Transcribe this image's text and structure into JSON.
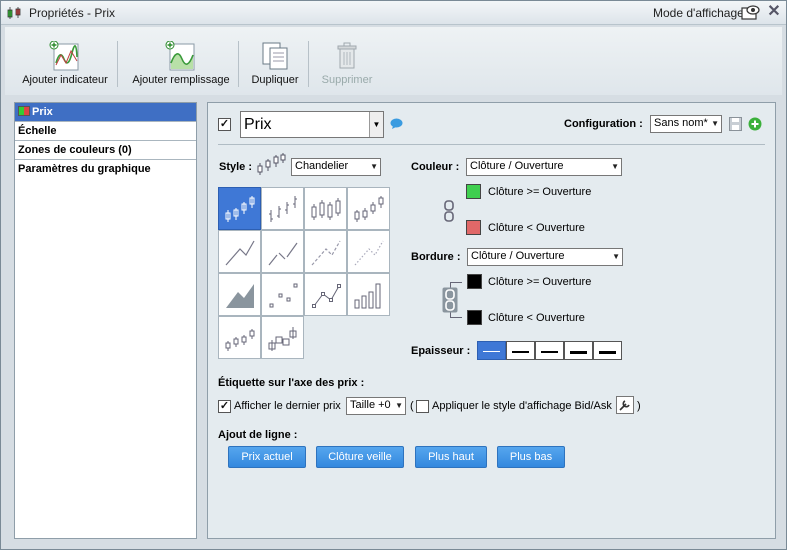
{
  "window": {
    "title": "Propriétés - Prix",
    "display_mode_label": "Mode d'affichage"
  },
  "toolbar": {
    "add_indicator": "Ajouter indicateur",
    "add_fill": "Ajouter remplissage",
    "duplicate": "Dupliquer",
    "delete": "Supprimer"
  },
  "sidebar": {
    "items": [
      {
        "label": "Prix",
        "selected": true
      },
      {
        "label": "Échelle"
      },
      {
        "label": "Zones de couleurs (0)"
      },
      {
        "label": "Paramètres du graphique"
      }
    ]
  },
  "main": {
    "enabled_checked": true,
    "name_value": "Prix",
    "configuration_label": "Configuration :",
    "configuration_value": "Sans nom*",
    "style_label": "Style :",
    "style_value": "Chandelier",
    "color_label": "Couleur :",
    "color_mode": "Clôture / Ouverture",
    "color_up_label": "Clôture >= Ouverture",
    "color_down_label": "Clôture < Ouverture",
    "color_up": "#3fcf4f",
    "color_down": "#e06868",
    "border_label": "Bordure :",
    "border_mode": "Clôture / Ouverture",
    "border_up_label": "Clôture >= Ouverture",
    "border_down_label": "Clôture < Ouverture",
    "border_up": "#000000",
    "border_down": "#000000",
    "thickness_label": "Epaisseur :",
    "price_axis_title": "Étiquette sur l'axe des prix :",
    "show_last_price_checked": true,
    "show_last_price_label": "Afficher le dernier prix",
    "size_value": "Taille +0",
    "open_paren": "(",
    "bidask_checked": false,
    "bidask_label": "Appliquer le style d'affichage Bid/Ask",
    "close_paren": ")",
    "add_line_title": "Ajout de ligne :",
    "line_buttons": [
      "Prix actuel",
      "Clôture veille",
      "Plus haut",
      "Plus bas"
    ]
  },
  "colors": {
    "accent": "#3f78d6",
    "selected_row": "#3f6fc4",
    "button_blue": "#3a90e2"
  }
}
